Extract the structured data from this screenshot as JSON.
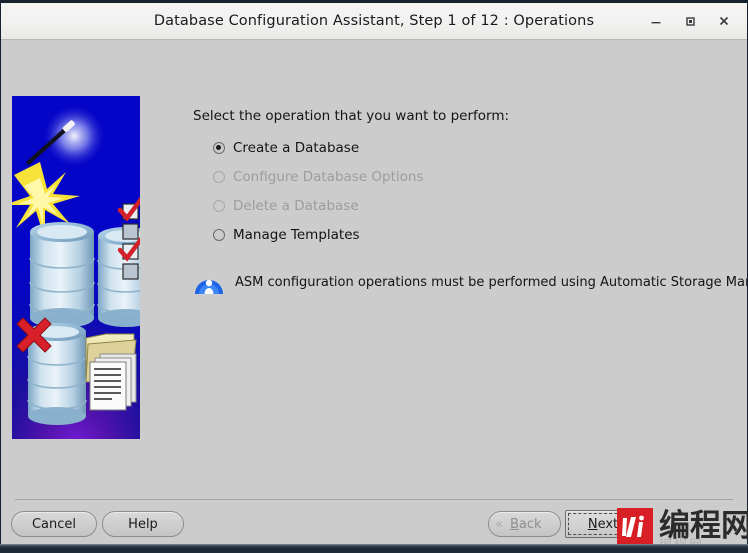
{
  "window": {
    "title": "Database Configuration Assistant, Step 1 of 12 : Operations",
    "minimize_label": "Minimize",
    "maximize_label": "Maximize",
    "close_label": "Close"
  },
  "main": {
    "prompt": "Select the operation that you want to perform:",
    "options": [
      {
        "label": "Create a Database",
        "selected": true,
        "disabled": false
      },
      {
        "label": "Configure Database Options",
        "selected": false,
        "disabled": true
      },
      {
        "label": "Delete a Database",
        "selected": false,
        "disabled": true
      },
      {
        "label": "Manage Templates",
        "selected": false,
        "disabled": false
      }
    ],
    "notice": {
      "icon": "asm-info-icon",
      "text": "ASM configuration operations must be performed using Automatic Storage Managemer"
    }
  },
  "footer": {
    "cancel_label": "Cancel",
    "help_label": "Help",
    "back_label": "Back",
    "back_mnemonic": "B",
    "next_label": "Next",
    "next_mnemonic": "N",
    "back_disabled": true,
    "next_focused": true
  },
  "watermark": {
    "word": "编程网",
    "sub": "编程网"
  },
  "colors": {
    "window_bg": "#cccccc",
    "titlebar_bg": "#f1f1f0",
    "illustration_blue": "#0a0ab8",
    "illustration_purple": "#6a18d8",
    "accent_red": "#d81f26",
    "text": "#141414",
    "disabled_text": "#9d9d9d"
  }
}
